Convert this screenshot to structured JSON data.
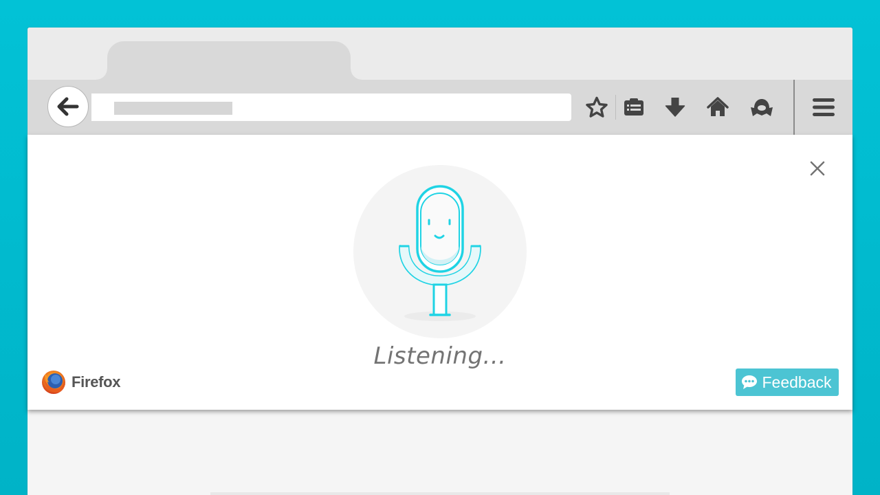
{
  "browser": {
    "toolbar": {
      "back_icon": "arrow-left-icon",
      "icons": [
        "star-icon",
        "reading-list-icon",
        "download-icon",
        "home-icon",
        "pocket-icon",
        "hamburger-menu-icon"
      ]
    }
  },
  "voice_panel": {
    "status_text": "Listening...",
    "brand_name": "Firefox",
    "feedback_label": "Feedback",
    "close_icon": "close-icon",
    "mic_icon": "microphone-mascot-icon"
  },
  "colors": {
    "background": "#00b8cc",
    "accent": "#1fd3e4",
    "feedback_button": "#4cc4d3",
    "icon_gray": "#4a4a4a"
  }
}
